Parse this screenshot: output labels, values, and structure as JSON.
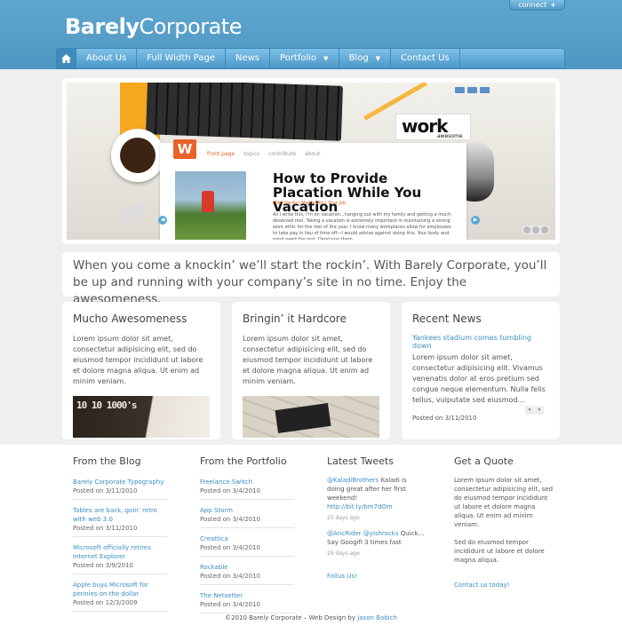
{
  "header": {
    "connect_label": "connect",
    "logo_bold": "Barely",
    "logo_light": "Corporate"
  },
  "nav": {
    "items": [
      {
        "label": "About Us"
      },
      {
        "label": "Full Width Page"
      },
      {
        "label": "News"
      },
      {
        "label": "Portfolio"
      },
      {
        "label": "Blog"
      },
      {
        "label": "Contact Us"
      }
    ]
  },
  "slider": {
    "badge": "W",
    "tabs": [
      "front page",
      "topics",
      "contribute",
      "about"
    ],
    "work_word": "work",
    "work_sub": "awesome",
    "title": "How to Provide Placation While You Vacation",
    "meta": "Mike Vardy | March 4th | Your Job",
    "body": "As I write this, I'm on vacation…hanging out with my family and getting a much-deserved rest. Taking a vacation is extremely important in maintaining a strong work ethic for the rest of the year. I know many workplaces allow for employees to take pay in lieu of time off—I would advise against doing this. Your body and mind need the rest. Depriving them"
  },
  "intro": "When you come a knockin’ we’ll start the rockin’. With Barely Corporate, you’ll be up and running with your company’s site in no time. Enjoy the awesomeness.",
  "boxes": [
    {
      "title": "Mucho Awesomeness",
      "text": "Lorem ipsum dolor sit amet, consectetur adipisicing elit, sed do eiusmod tempor incididunt ut labore et dolore magna aliqua. Ut enim ad minim veniam.",
      "thumb_text": "10 10 1000's"
    },
    {
      "title": "Bringin’ it Hardcore",
      "text": "Lorem ipsum dolor sit amet, consectetur adipisicing elit, sed do eiusmod tempor incididunt ut labore et dolore magna aliqua. Ut enim ad minim veniam."
    },
    {
      "title": "Recent News",
      "link": "Yankees stadium comes tumbling down",
      "text": "Lorem ipsum dolor sit amet, consectetur adipisicing elit. Vivamus venenatis dolor at eros pretium sed congue neque elementum. Nulla felis tellus, vulputate sed eiusmod…",
      "posted": "Posted on 3/11/2010",
      "prev": "«",
      "next": "»"
    }
  ],
  "footer": {
    "blog": {
      "title": "From the Blog",
      "items": [
        {
          "t": "Barely Corporate Typography",
          "d": "Posted on 3/11/2010"
        },
        {
          "t": "Tables are back, goin’ retro with web 3.0",
          "d": "Posted on 3/11/2010"
        },
        {
          "t": "Microsoft officially retires Internet Explorer",
          "d": "Posted on 3/9/2010"
        },
        {
          "t": "Apple buys Microsoft for pennies on the dollar",
          "d": "Posted on 12/3/2009"
        }
      ]
    },
    "portfolio": {
      "title": "From the Portfolio",
      "items": [
        {
          "t": "Freelance Switch",
          "d": "Posted on 3/4/2010"
        },
        {
          "t": "App Storm",
          "d": "Posted on 3/4/2010"
        },
        {
          "t": "Creattica",
          "d": "Posted on 3/4/2010"
        },
        {
          "t": "Rockable",
          "d": "Posted on 3/4/2010"
        },
        {
          "t": "The Netsetter",
          "d": "Posted on 3/4/2010"
        }
      ]
    },
    "tweets": {
      "title": "Latest Tweets",
      "items": [
        {
          "user": "@KaladiBrothers",
          "text": "Kaladi is doing great after her first weekend!",
          "link": "http://bit.ly/bm7dOm",
          "ago": "25 days ago"
        },
        {
          "user": "@AncRider",
          "user2": "@yishrocks",
          "text": "Quick… Say Googifi 3 times fast",
          "ago": "29 days ago"
        }
      ],
      "follow": "Follus Us!"
    },
    "quote": {
      "title": "Get a Quote",
      "p1": "Lorem ipsum dolor sit amet, consectetur adipisicing elit, sed do eiusmod tempor incididunt ut labore et dolore magna aliqua. Ut enim ad minim veniam.",
      "p2": "Sed do eiusmod tempor incididunt ut labore et dolore magna aliqua.",
      "link": "Contact us today!"
    },
    "copyright": "©2010 Barely Corporate – Web Design by",
    "author": "Jason Bobich"
  }
}
